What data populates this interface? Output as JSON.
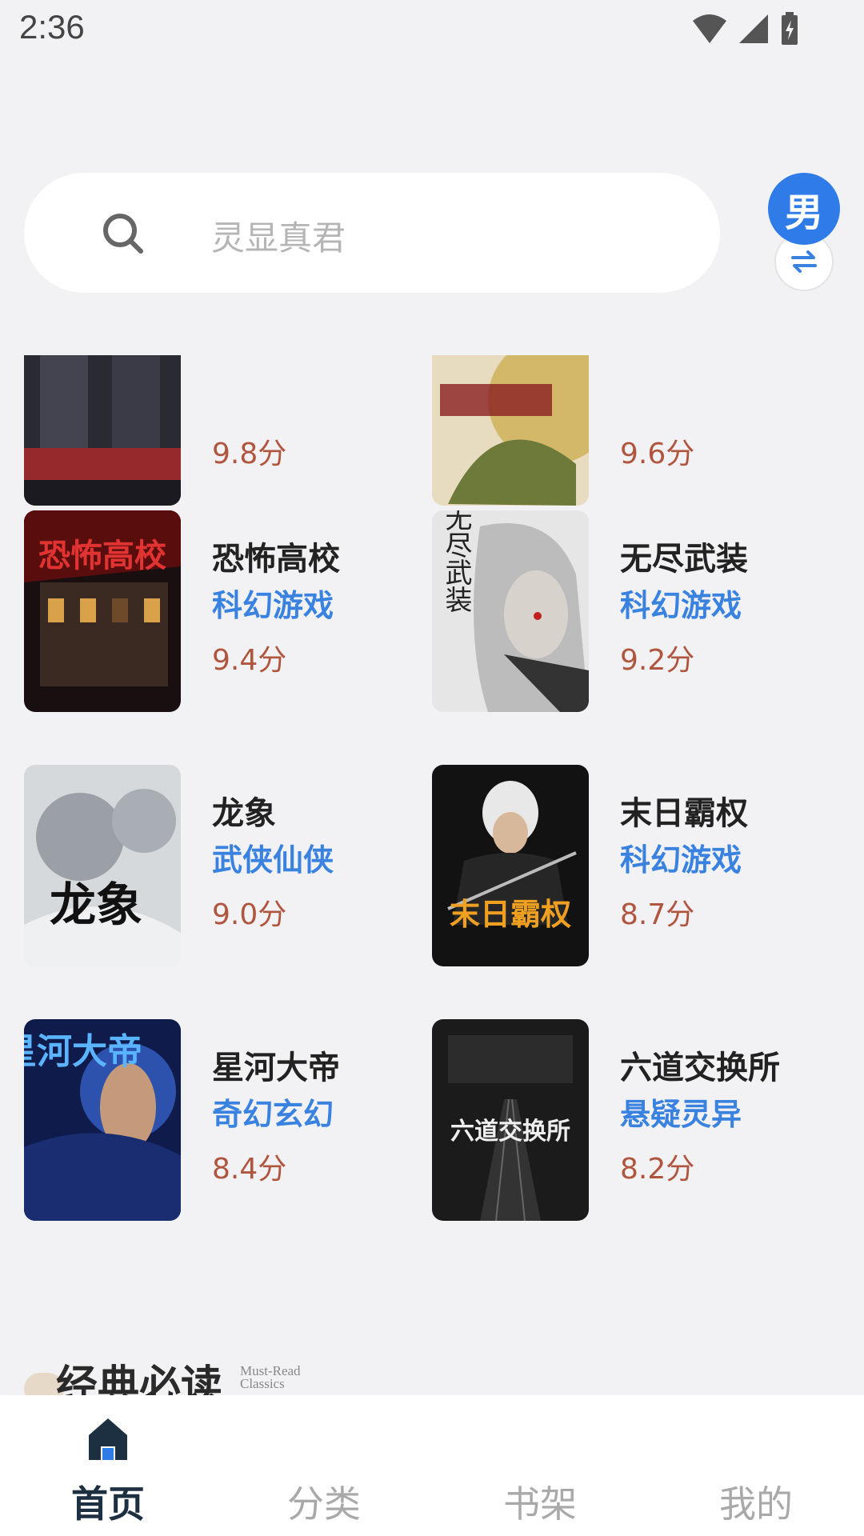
{
  "status": {
    "time": "2:36"
  },
  "search": {
    "placeholder": "灵显真君"
  },
  "gender": {
    "label": "男"
  },
  "partial_top": [
    {
      "score": "9.8分"
    },
    {
      "score": "9.6分"
    }
  ],
  "books": [
    {
      "title": "恐怖高校",
      "genre": "科幻游戏",
      "score": "9.4分",
      "cover_text": "恐怖高校"
    },
    {
      "title": "无尽武装",
      "genre": "科幻游戏",
      "score": "9.2分",
      "cover_text": "无尽武装"
    },
    {
      "title": "龙象",
      "genre": "武侠仙侠",
      "score": "9.0分",
      "cover_text": "龙象"
    },
    {
      "title": "末日霸权",
      "genre": "科幻游戏",
      "score": "8.7分",
      "cover_text": "末日霸权"
    },
    {
      "title": "星河大帝",
      "genre": "奇幻玄幻",
      "score": "8.4分",
      "cover_text": "星河大帝"
    },
    {
      "title": "六道交换所",
      "genre": "悬疑灵异",
      "score": "8.2分",
      "cover_text": "六道交换所"
    }
  ],
  "section": {
    "title": "经典必读",
    "subtitle_1": "Must-Read",
    "subtitle_2": "Classics"
  },
  "tabs": [
    {
      "label": "首页",
      "active": true
    },
    {
      "label": "分类"
    },
    {
      "label": "书架"
    },
    {
      "label": "我的"
    }
  ],
  "colors": {
    "accent": "#2f7ce9",
    "genre": "#3a82e0",
    "score": "#b0553e",
    "tab_active": "#1d3042"
  }
}
